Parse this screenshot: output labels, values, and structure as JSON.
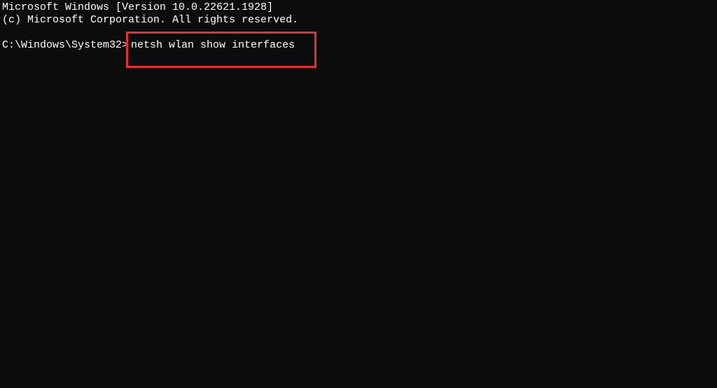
{
  "banner": {
    "line1": "Microsoft Windows [Version 10.0.22621.1928]",
    "line2": "(c) Microsoft Corporation. All rights reserved."
  },
  "prompt": "C:\\Windows\\System32>",
  "command": "netsh wlan show interfaces"
}
